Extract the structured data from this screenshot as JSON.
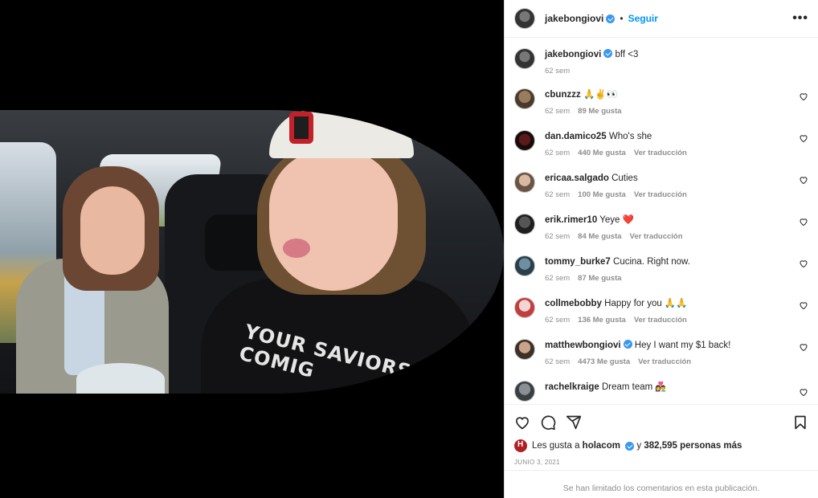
{
  "post": {
    "author": "jakebongiovi",
    "follow_label": "Seguir",
    "dot": "•",
    "more_label": "•••",
    "caption": "bff <3",
    "caption_time": "62 sem"
  },
  "photo": {
    "shirt_print": "YOUR SAVIORS COMIG"
  },
  "comments": [
    {
      "user": "cbunzzz",
      "text": "🙏✌️👀",
      "time": "62 sem",
      "likes": "89 Me gusta",
      "translate": ""
    },
    {
      "user": "dan.damico25",
      "text": "Who's she",
      "time": "62 sem",
      "likes": "440 Me gusta",
      "translate": "Ver traducción"
    },
    {
      "user": "ericaa.salgado",
      "text": "Cuties",
      "time": "62 sem",
      "likes": "100 Me gusta",
      "translate": "Ver traducción"
    },
    {
      "user": "erik.rimer10",
      "text": "Yeye ❤️",
      "time": "62 sem",
      "likes": "84 Me gusta",
      "translate": "Ver traducción"
    },
    {
      "user": "tommy_burke7",
      "text": "Cucina. Right now.",
      "time": "62 sem",
      "likes": "87 Me gusta",
      "translate": ""
    },
    {
      "user": "collmebobby",
      "text": "Happy for you 🙏🙏",
      "time": "62 sem",
      "likes": "136 Me gusta",
      "translate": "Ver traducción"
    },
    {
      "user": "matthewbongiovi",
      "text": "Hey I want my $1 back!",
      "time": "62 sem",
      "likes": "4473 Me gusta",
      "translate": "Ver traducción",
      "verified": true
    },
    {
      "user": "rachelkraige",
      "text": "Dream team 👩‍❤️‍👨",
      "time": "",
      "likes": "",
      "translate": ""
    }
  ],
  "likes_summary": {
    "prefix": "Les gusta a",
    "liker": "holacom",
    "middle": "y",
    "count": "382,595 personas más"
  },
  "date": "JUNIO 3, 2021",
  "footer": "Se han limitado los comentarios en esta publicación."
}
